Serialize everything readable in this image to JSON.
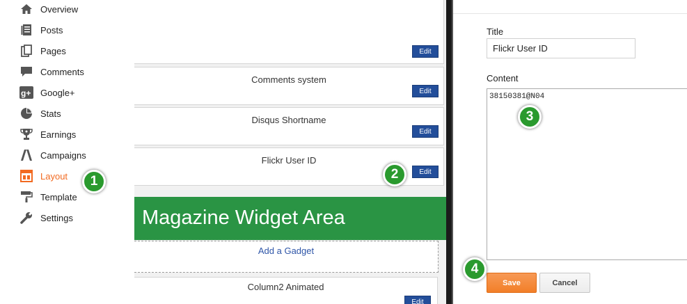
{
  "sidebar": {
    "items": [
      {
        "label": "Overview",
        "icon": "home-icon"
      },
      {
        "label": "Posts",
        "icon": "posts-icon"
      },
      {
        "label": "Pages",
        "icon": "pages-icon"
      },
      {
        "label": "Comments",
        "icon": "comments-icon"
      },
      {
        "label": "Google+",
        "icon": "google-plus-icon"
      },
      {
        "label": "Stats",
        "icon": "stats-icon"
      },
      {
        "label": "Earnings",
        "icon": "trophy-icon"
      },
      {
        "label": "Campaigns",
        "icon": "campaigns-icon"
      },
      {
        "label": "Layout",
        "icon": "layout-icon",
        "active": true
      },
      {
        "label": "Template",
        "icon": "paint-roller-icon"
      },
      {
        "label": "Settings",
        "icon": "wrench-icon"
      }
    ]
  },
  "layout": {
    "gadgets": [
      {
        "title": "",
        "edit_label": "Edit"
      },
      {
        "title": "Comments system",
        "edit_label": "Edit"
      },
      {
        "title": "Disqus Shortname",
        "edit_label": "Edit"
      },
      {
        "title": "Flickr User ID",
        "edit_label": "Edit"
      }
    ],
    "section_title": "Magazine Widget Area",
    "add_gadget_label": "Add a Gadget",
    "column2": {
      "title": "Column2 Animated",
      "edit_label": "Edit"
    }
  },
  "dialog": {
    "title_label": "Title",
    "title_value": "Flickr User ID",
    "content_label": "Content",
    "content_value": "38150381@N04",
    "save_label": "Save",
    "cancel_label": "Cancel"
  },
  "steps": [
    "1",
    "2",
    "3",
    "4"
  ],
  "colors": {
    "accent": "#f26a21",
    "edit_button": "#234e9a",
    "section_green": "#2a9444",
    "step_green": "#2a9a2e"
  }
}
